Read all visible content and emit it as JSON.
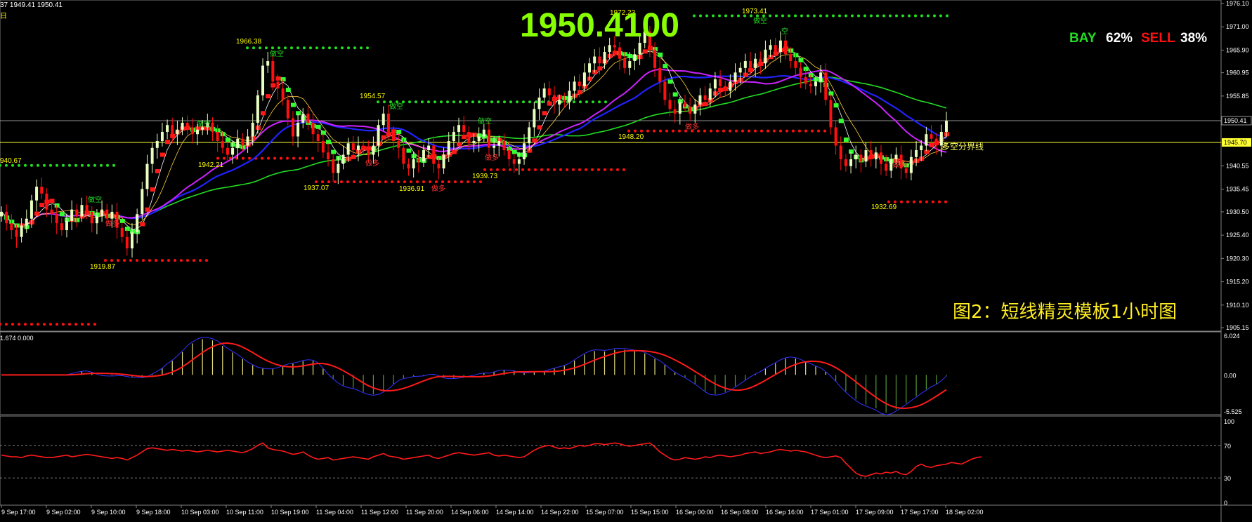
{
  "header": {
    "ohlc_fragment": "37 1949.41 1950.41",
    "sub_fragment": "日",
    "big_price": "1950.4100"
  },
  "sentiment": {
    "buy_label": "BAY",
    "buy_pct": "62%",
    "sell_label": "SELL",
    "sell_pct": "38%"
  },
  "caption": "图2：短线精灵模板1小时图",
  "colors": {
    "candle_up": "#e8ffc0",
    "candle_down": "#ff1010",
    "price_label": "#ffff00",
    "buy": "#22dd22",
    "sell": "#ff1010",
    "ma_green": "#22dd22",
    "ma_purple": "#cc22ff",
    "ma_blue": "#2222ff",
    "big_price": "#88ff00"
  },
  "chart_data": {
    "type": "line",
    "title": "",
    "price_axis": {
      "ticks": [
        "1976.10",
        "1971.00",
        "1965.90",
        "1960.95",
        "1955.85",
        "1950.75",
        "1945.70",
        "1940.55",
        "1935.45",
        "1930.50",
        "1925.40",
        "1920.30",
        "1915.20",
        "1910.10",
        "1905.15"
      ],
      "ylim": [
        1905.15,
        1976.1
      ]
    },
    "current_price": "1950.41",
    "divider_price": "1945.70",
    "divider_label": "多空分界线",
    "price_levels": [
      {
        "value": "1966.38",
        "label": "1966.38",
        "side": "sell"
      },
      {
        "value": "1954.57",
        "label": "1954.57",
        "side": "sell"
      },
      {
        "value": "1973.41",
        "label": "1973.41",
        "side": "sell"
      },
      {
        "value": "1972.23",
        "label": "1972.23",
        "side": "sell"
      },
      {
        "value": "1940.67",
        "label": "940.67",
        "side": "sell"
      },
      {
        "value": "1919.87",
        "label": "1919.87",
        "side": "buy"
      },
      {
        "value": "1942.21",
        "label": "1942.21",
        "side": "buy"
      },
      {
        "value": "1937.07",
        "label": "1937.07",
        "side": "buy"
      },
      {
        "value": "1936.91",
        "label": "1936.91",
        "side": "buy"
      },
      {
        "value": "1939.73",
        "label": "1939.73",
        "side": "buy"
      },
      {
        "value": "1948.20",
        "label": "1948.20",
        "side": "buy"
      },
      {
        "value": "1932.69",
        "label": "1932.69",
        "side": "buy"
      }
    ],
    "signal_labels": [
      "做空",
      "做多",
      "空"
    ],
    "time_labels": [
      "9 Sep 17:00",
      "9 Sep 02:00",
      "9 Sep 10:00",
      "9 Sep 18:00",
      "10 Sep 03:00",
      "10 Sep 11:00",
      "10 Sep 19:00",
      "11 Sep 04:00",
      "11 Sep 12:00",
      "11 Sep 20:00",
      "14 Sep 06:00",
      "14 Sep 14:00",
      "14 Sep 22:00",
      "15 Sep 07:00",
      "15 Sep 15:00",
      "16 Sep 00:00",
      "16 Sep 08:00",
      "16 Sep 16:00",
      "17 Sep 01:00",
      "17 Sep 09:00",
      "17 Sep 17:00",
      "18 Sep 02:00"
    ],
    "close_series": [
      1930.5,
      1928,
      1926.5,
      1925,
      1927.5,
      1929,
      1933,
      1936,
      1934.5,
      1931,
      1930,
      1928,
      1926.5,
      1928.5,
      1931,
      1929.5,
      1932,
      1930.5,
      1928,
      1929.5,
      1931,
      1929,
      1930.5,
      1927,
      1925,
      1922.5,
      1926,
      1930,
      1935.5,
      1941,
      1944.5,
      1946,
      1948,
      1949.5,
      1947.5,
      1948.5,
      1950,
      1949,
      1947.5,
      1948.5,
      1949,
      1950,
      1948,
      1946,
      1944.5,
      1943,
      1944.5,
      1946.5,
      1945,
      1947,
      1950,
      1956,
      1962.5,
      1963.5,
      1959,
      1957.5,
      1955,
      1951,
      1947,
      1950,
      1952,
      1950,
      1947.5,
      1946,
      1943.5,
      1942,
      1939,
      1941,
      1943,
      1945.5,
      1944,
      1945,
      1944.5,
      1943,
      1945,
      1949.5,
      1952,
      1948,
      1946,
      1944.5,
      1941,
      1940,
      1942,
      1941.5,
      1944,
      1945,
      1941,
      1940,
      1943,
      1946,
      1948,
      1949.5,
      1948,
      1945.5,
      1946,
      1947,
      1948.5,
      1944.5,
      1945,
      1946,
      1944,
      1942,
      1941,
      1942,
      1945.5,
      1949,
      1953,
      1955.5,
      1957.5,
      1956,
      1954,
      1955,
      1954.5,
      1957,
      1959,
      1958,
      1961,
      1963,
      1964.5,
      1963,
      1965.5,
      1967,
      1966.5,
      1964,
      1962,
      1963.5,
      1965,
      1967.5,
      1970,
      1966,
      1962,
      1959,
      1955,
      1953,
      1952,
      1954.5,
      1953.5,
      1952,
      1954,
      1956,
      1955,
      1957.5,
      1959.5,
      1958,
      1957,
      1959,
      1961,
      1962,
      1963.5,
      1962,
      1964,
      1963,
      1966,
      1967,
      1965.5,
      1968,
      1965,
      1963.5,
      1962,
      1960,
      1958.5,
      1958,
      1959,
      1961,
      1955,
      1949,
      1945,
      1942,
      1940.5,
      1942,
      1943,
      1941.5,
      1944,
      1942,
      1943.5,
      1941,
      1939.5,
      1942,
      1943,
      1940,
      1939,
      1942.5,
      1944,
      1945,
      1947.5,
      1946.5,
      1945,
      1948,
      1950.41
    ],
    "volume_subpanel": {
      "header": "1.674 0.000",
      "ticks": [
        "6.024",
        "0.00",
        "-5.525"
      ],
      "ylim": [
        -5.525,
        6.024
      ]
    },
    "rsi_subpanel": {
      "ticks": [
        "100",
        "70",
        "30",
        "0"
      ],
      "levels": [
        70,
        30
      ],
      "ylim": [
        0,
        100
      ],
      "values": [
        58,
        57,
        56,
        56,
        55,
        57,
        58,
        57,
        56,
        55,
        55,
        56,
        57,
        58,
        56,
        57,
        58,
        59,
        58,
        57,
        56,
        55,
        54,
        55,
        54,
        52,
        55,
        58,
        62,
        66,
        67,
        66,
        65,
        64,
        65,
        64,
        63,
        64,
        63,
        62,
        63,
        64,
        63,
        62,
        63,
        64,
        63,
        62,
        61,
        63,
        66,
        70,
        73,
        67,
        65,
        64,
        63,
        61,
        59,
        60,
        62,
        58,
        55,
        53,
        54,
        55,
        52,
        53,
        54,
        55,
        56,
        55,
        54,
        53,
        56,
        58,
        60,
        57,
        56,
        55,
        53,
        54,
        55,
        56,
        57,
        58,
        55,
        54,
        56,
        58,
        60,
        61,
        60,
        59,
        58,
        59,
        60,
        61,
        58,
        57,
        58,
        57,
        56,
        55,
        56,
        60,
        64,
        67,
        69,
        70,
        68,
        66,
        67,
        66,
        68,
        70,
        69,
        70,
        72,
        72,
        71,
        72,
        73,
        72,
        70,
        69,
        70,
        71,
        72,
        73,
        68,
        62,
        58,
        54,
        52,
        53,
        55,
        54,
        53,
        54,
        56,
        55,
        57,
        58,
        57,
        56,
        57,
        58,
        60,
        61,
        62,
        60,
        61,
        62,
        64,
        65,
        64,
        63,
        64,
        63,
        62,
        60,
        58,
        56,
        55,
        56,
        57,
        55,
        48,
        42,
        36,
        33,
        32,
        34,
        36,
        35,
        37,
        36,
        38,
        35,
        34,
        38,
        44,
        47,
        44,
        43,
        45,
        46,
        47,
        49,
        48,
        47,
        50,
        53,
        55,
        56
      ]
    }
  }
}
